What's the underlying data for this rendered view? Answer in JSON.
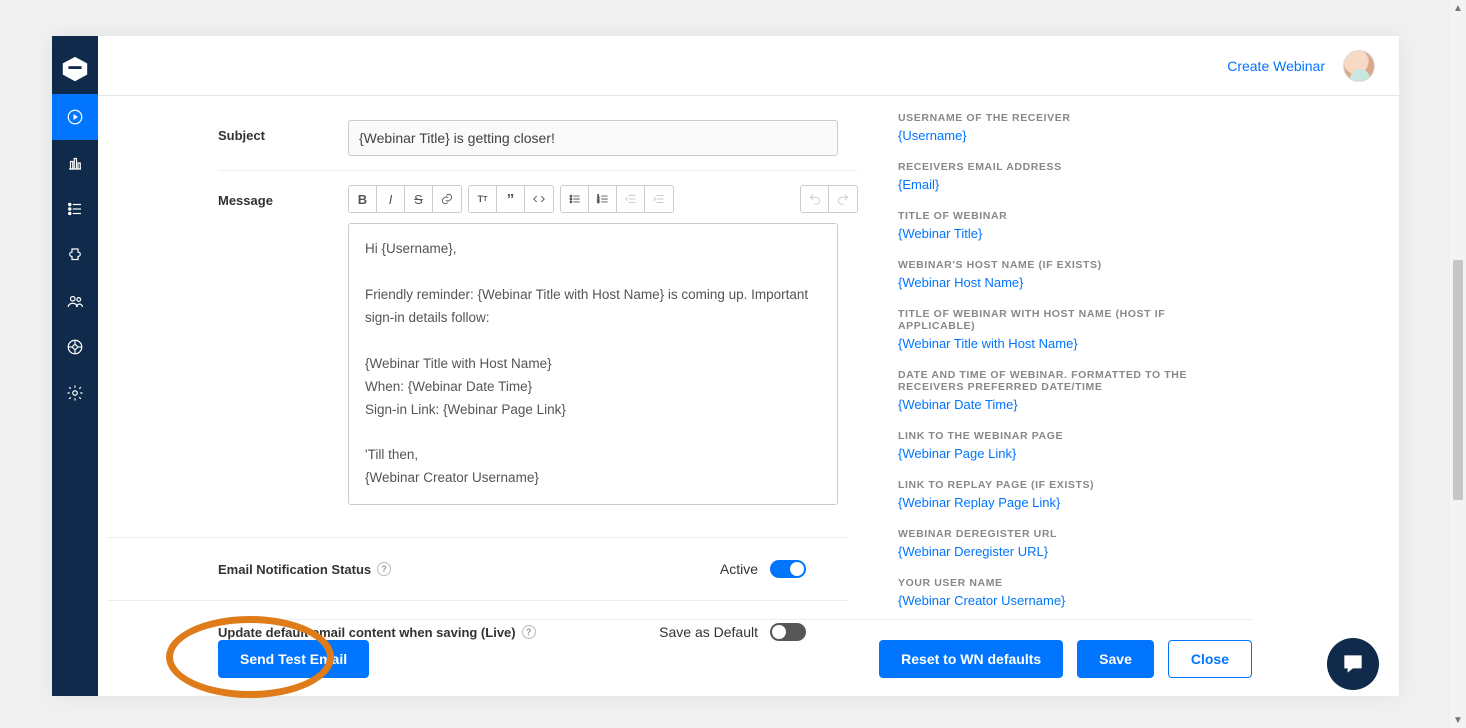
{
  "header": {
    "create_webinar": "Create Webinar"
  },
  "form": {
    "subject_label": "Subject",
    "subject_value": "{Webinar Title} is getting closer!",
    "message_label": "Message",
    "message_body": "Hi {Username},\n\nFriendly reminder: {Webinar Title with Host Name} is coming up. Important sign-in details follow:\n\n{Webinar Title with Host Name}\nWhen: {Webinar Date Time}\nSign-in Link: {Webinar Page Link}\n\n'Till then,\n{Webinar Creator Username}"
  },
  "status": {
    "notif_label": "Email Notification Status",
    "notif_value": "Active",
    "update_label": "Update default email content when saving (Live)",
    "update_value": "Save as Default"
  },
  "vars": [
    {
      "title": "Username of the receiver",
      "token": "{Username}"
    },
    {
      "title": "Receivers email address",
      "token": "{Email}"
    },
    {
      "title": "Title of webinar",
      "token": "{Webinar Title}"
    },
    {
      "title": "Webinar's host name (if exists)",
      "token": "{Webinar Host Name}"
    },
    {
      "title": "Title of webinar with host name (host if applicable)",
      "token": "{Webinar Title with Host Name}"
    },
    {
      "title": "Date and time of webinar. Formatted to the receivers preferred date/time",
      "token": "{Webinar Date Time}"
    },
    {
      "title": "Link to the webinar page",
      "token": "{Webinar Page Link}"
    },
    {
      "title": "Link to replay page (if exists)",
      "token": "{Webinar Replay Page Link}"
    },
    {
      "title": "Webinar deregister URL",
      "token": "{Webinar Deregister URL}"
    },
    {
      "title": "Your user name",
      "token": "{Webinar Creator Username}"
    }
  ],
  "footer": {
    "send_test": "Send Test Email",
    "reset": "Reset to WN defaults",
    "save": "Save",
    "close": "Close"
  }
}
